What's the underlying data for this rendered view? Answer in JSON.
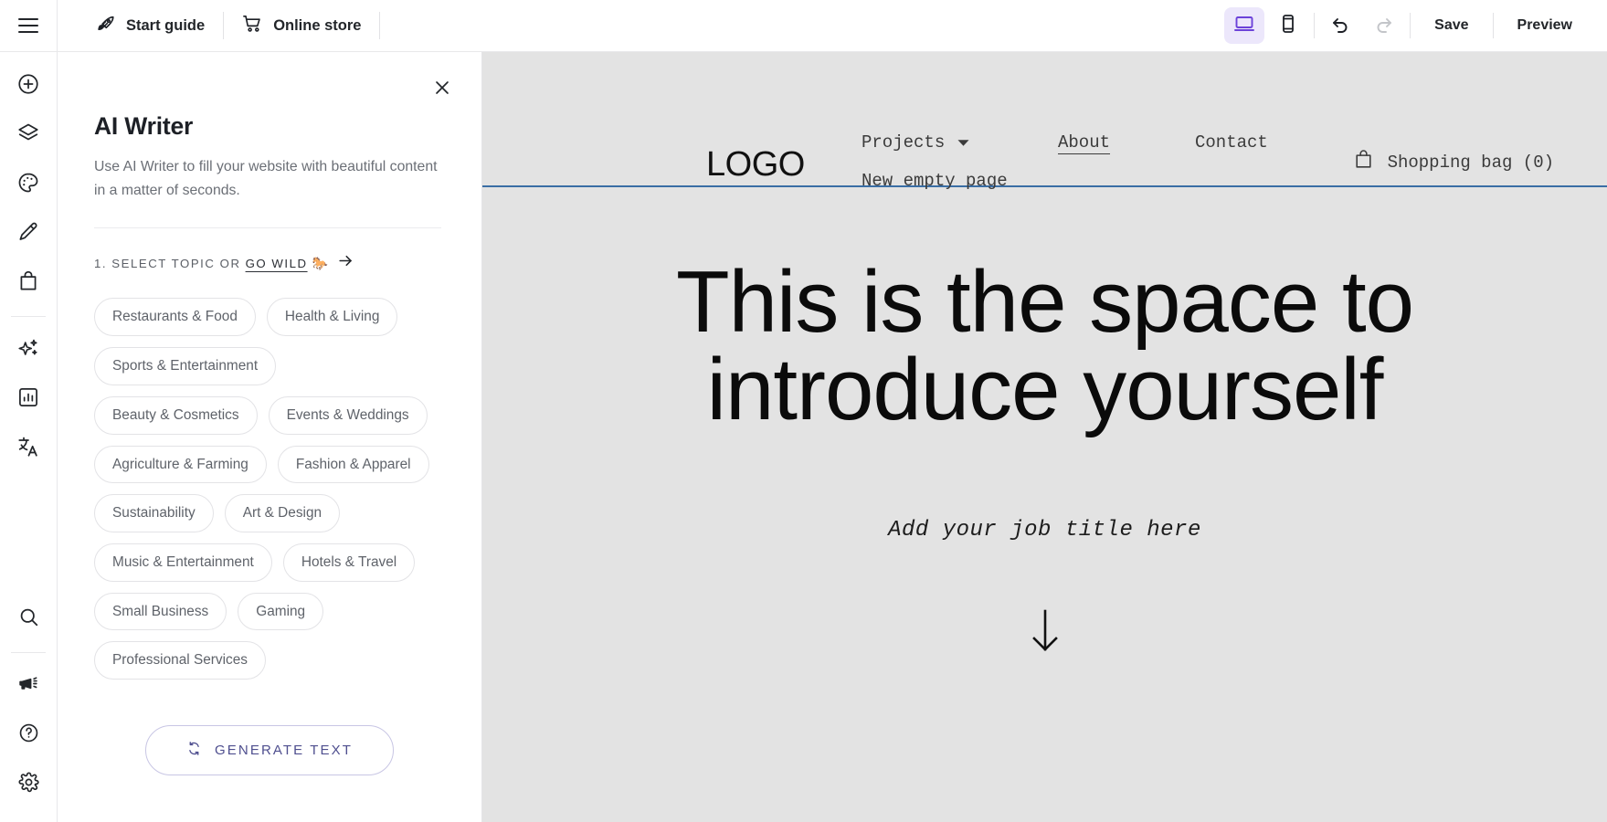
{
  "topbar": {
    "menu_icon": "hamburger-icon",
    "items": [
      {
        "label": "Start guide",
        "icon": "rocket-icon"
      },
      {
        "label": "Online store",
        "icon": "shopping-cart-icon"
      }
    ],
    "devices": [
      {
        "name": "desktop",
        "icon": "desktop-icon",
        "active": true
      },
      {
        "name": "mobile",
        "icon": "mobile-icon",
        "active": false
      }
    ],
    "history": [
      {
        "name": "undo",
        "icon": "undo-icon",
        "enabled": true
      },
      {
        "name": "redo",
        "icon": "redo-icon",
        "enabled": false
      }
    ],
    "save_label": "Save",
    "preview_label": "Preview",
    "accent_active": "#6c42d9",
    "accent_active_bg": "#ece7fb"
  },
  "rail": {
    "items": [
      {
        "name": "add",
        "icon": "plus-circle-icon"
      },
      {
        "name": "layers",
        "icon": "layers-icon"
      },
      {
        "name": "design",
        "icon": "palette-icon"
      },
      {
        "name": "edit",
        "icon": "pencil-icon"
      },
      {
        "name": "store",
        "icon": "shopping-bag-icon"
      },
      {
        "name": "ai-tools",
        "icon": "sparkles-icon"
      },
      {
        "name": "analytics",
        "icon": "chart-icon"
      },
      {
        "name": "languages",
        "icon": "translate-icon"
      },
      {
        "name": "search",
        "icon": "search-icon"
      },
      {
        "name": "announcements",
        "icon": "megaphone-icon"
      },
      {
        "name": "help",
        "icon": "question-circle-icon"
      },
      {
        "name": "settings",
        "icon": "gear-icon"
      }
    ]
  },
  "panel": {
    "close_icon": "close-icon",
    "title": "AI Writer",
    "description": "Use AI Writer to fill your website with beautiful content in a matter of seconds.",
    "step_label": "1. SELECT TOPIC OR",
    "go_wild_label": "GO WILD",
    "go_wild_emoji": "🐎",
    "go_wild_arrow_icon": "arrow-right-icon",
    "topics": [
      "Restaurants & Food",
      "Health & Living",
      "Sports & Entertainment",
      "Beauty & Cosmetics",
      "Events & Weddings",
      "Agriculture & Farming",
      "Fashion & Apparel",
      "Sustainability",
      "Art & Design",
      "Music & Entertainment",
      "Hotels & Travel",
      "Small Business",
      "Gaming",
      "Professional Services"
    ],
    "generate_label": "GENERATE TEXT",
    "generate_icon": "refresh-icon",
    "generate_color": "#4f4f8f"
  },
  "preview": {
    "logo": "LOGO",
    "nav": [
      {
        "label": "Projects",
        "has_dropdown": true,
        "underlined": false
      },
      {
        "label": "New empty page",
        "has_dropdown": false,
        "underlined": false
      },
      {
        "label": "About",
        "has_dropdown": false,
        "underlined": true
      },
      {
        "label": "Contact",
        "has_dropdown": false,
        "underlined": false
      }
    ],
    "cart_label": "Shopping bag (0)",
    "cart_icon": "shopping-bag-icon",
    "selection_color": "#3a6ea5",
    "hero_heading": "This is the space to introduce yourself",
    "hero_subheading": "Add your job title here",
    "scroll_icon": "arrow-down-icon",
    "background": "#e3e3e3"
  }
}
